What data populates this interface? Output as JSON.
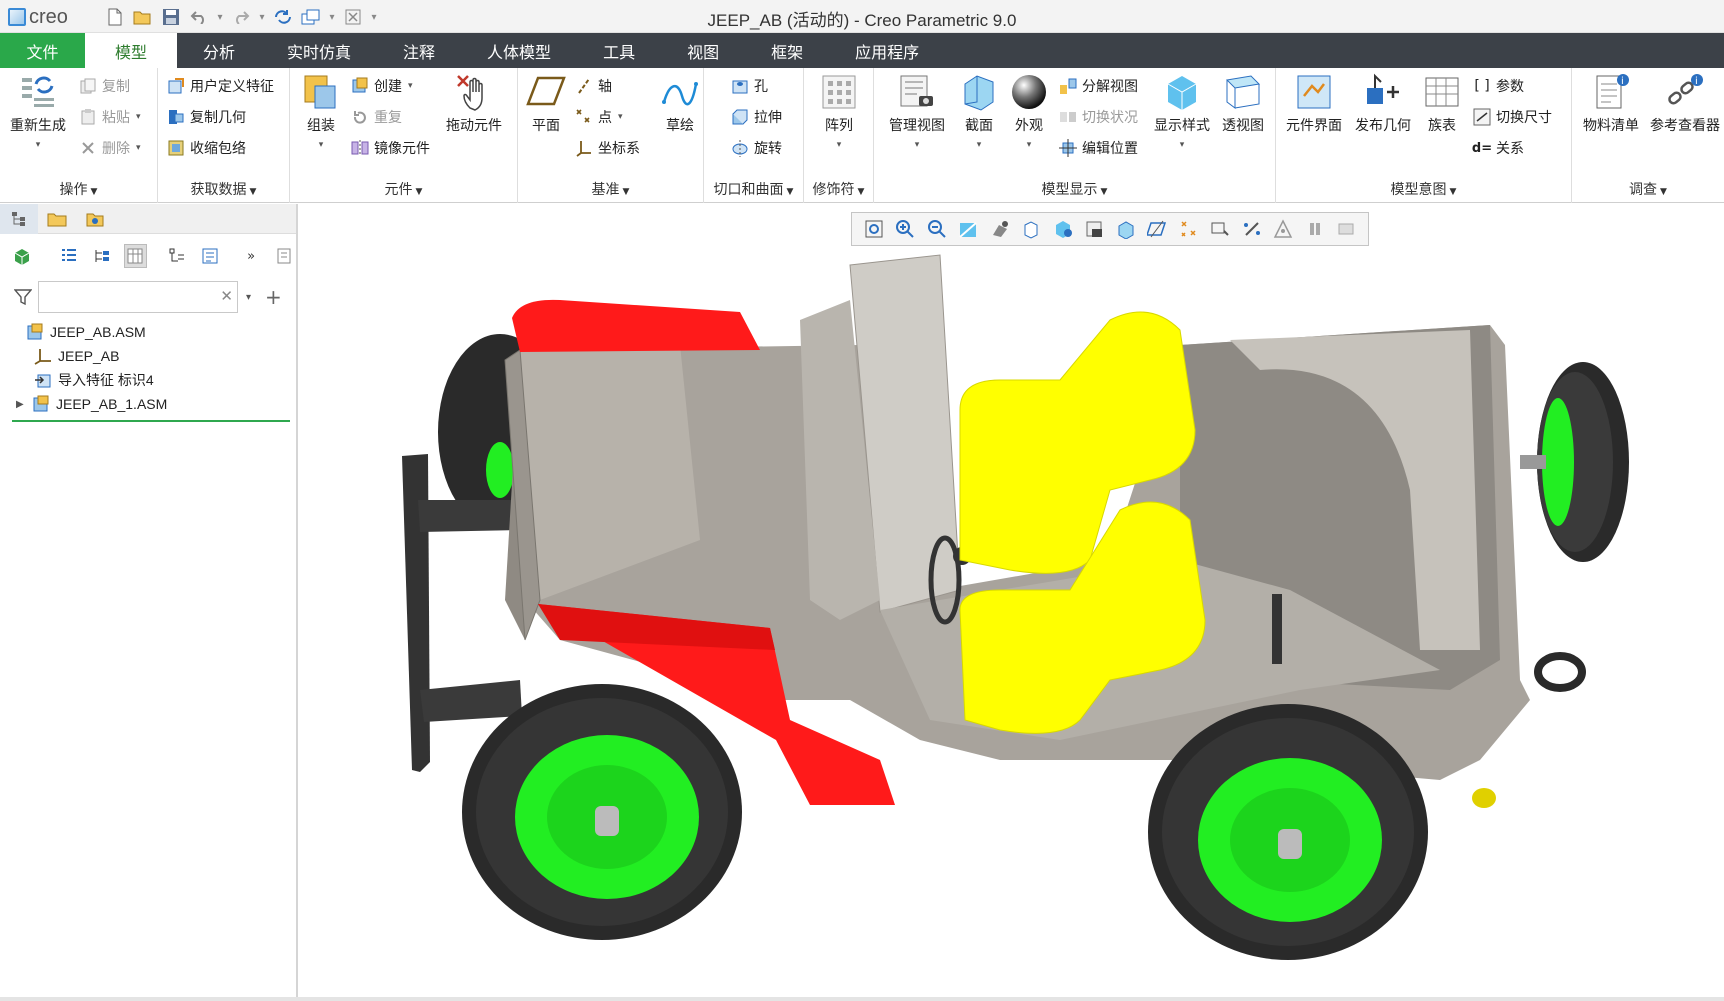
{
  "app": {
    "logo_text": "creo",
    "window_title": "JEEP_AB (活动的) - Creo Parametric 9.0"
  },
  "tabs": [
    {
      "label": "文件"
    },
    {
      "label": "模型"
    },
    {
      "label": "分析"
    },
    {
      "label": "实时仿真"
    },
    {
      "label": "注释"
    },
    {
      "label": "人体模型"
    },
    {
      "label": "工具"
    },
    {
      "label": "视图"
    },
    {
      "label": "框架"
    },
    {
      "label": "应用程序"
    }
  ],
  "ribbon": {
    "operations": {
      "label": "操作",
      "regenerate": "重新生成",
      "copy": "复制",
      "paste": "粘贴",
      "delete": "删除"
    },
    "get_data": {
      "label": "获取数据",
      "udf": "用户定义特征",
      "copy_geom": "复制几何",
      "shrinkwrap": "收缩包络"
    },
    "component": {
      "label": "元件",
      "assemble": "组装",
      "create": "创建",
      "repeat": "重复",
      "mirror": "镜像元件",
      "drag": "拖动元件"
    },
    "datum": {
      "label": "基准",
      "plane": "平面",
      "axis": "轴",
      "point": "点",
      "csys": "坐标系",
      "sketch": "草绘"
    },
    "cut_surface": {
      "label": "切口和曲面",
      "hole": "孔",
      "extrude": "拉伸",
      "revolve": "旋转"
    },
    "modifiers": {
      "label": "修饰符",
      "pattern": "阵列"
    },
    "model_display": {
      "label": "模型显示",
      "manage_views": "管理视图",
      "section": "截面",
      "appearance": "外观",
      "explode": "分解视图",
      "toggle_status": "切换状况",
      "edit_position": "编辑位置",
      "display_style": "显示样式",
      "perspective": "透视图"
    },
    "model_intent": {
      "label": "模型意图",
      "component_interface": "元件界面",
      "publish_geom": "发布几何",
      "family_table": "族表",
      "parameters": "参数",
      "switch_dims": "切换尺寸",
      "relations": "关系"
    },
    "investigate": {
      "label": "调查",
      "bom": "物料清单",
      "ref_viewer": "参考查看器"
    }
  },
  "model_tree": {
    "search_value": "",
    "items": [
      {
        "label": "JEEP_AB.ASM"
      },
      {
        "label": "JEEP_AB"
      },
      {
        "label": "导入特征 标识4"
      },
      {
        "label": "JEEP_AB_1.ASM"
      }
    ]
  },
  "colors": {
    "file_tab": "#2aa84a",
    "tab_bar": "#3c4148",
    "active_tab_text": "#2f7d2f",
    "body": "#a8a39c",
    "fender_red": "#ff1a1a",
    "seat_yellow": "#ffff00",
    "wheel_green": "#22ee22",
    "tire": "#2a2a2a"
  }
}
